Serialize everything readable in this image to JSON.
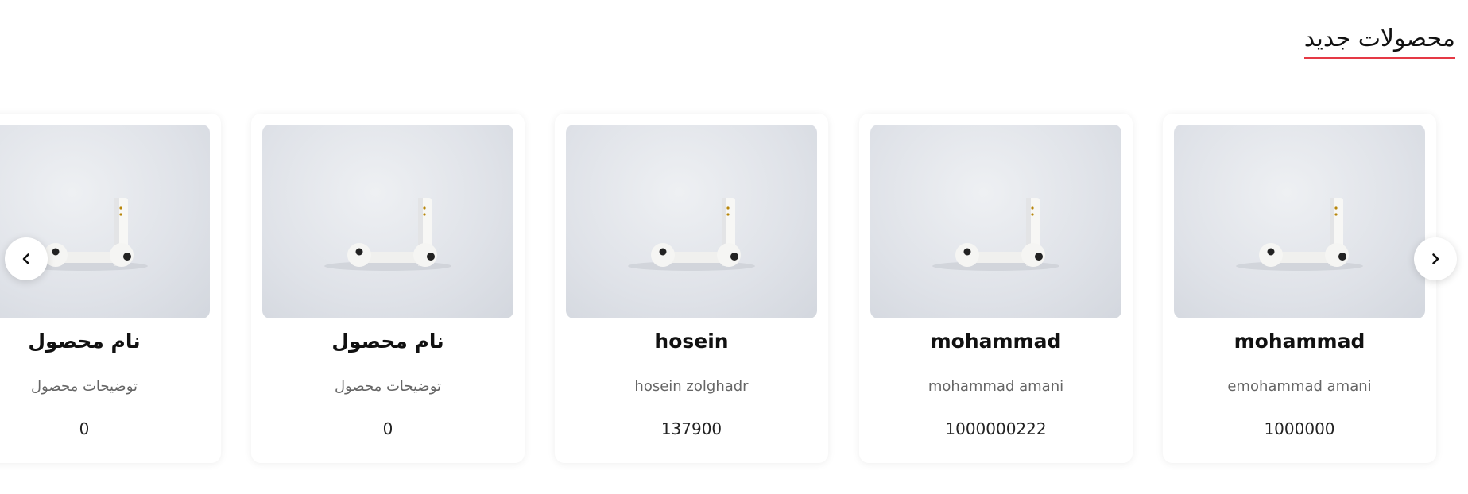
{
  "section": {
    "title": "محصولات جدید"
  },
  "carousel": {
    "prev_icon": "chevron-left-icon",
    "next_icon": "chevron-right-icon",
    "products": [
      {
        "name": "mohammad",
        "description": "emohammad amani",
        "price": "1000000"
      },
      {
        "name": "mohammad",
        "description": "mohammad amani",
        "price": "1000000222"
      },
      {
        "name": "hosein",
        "description": "hosein zolghadr",
        "price": "137900"
      },
      {
        "name": "نام محصول",
        "description": "توضیحات محصول",
        "price": "0"
      },
      {
        "name": "نام محصول",
        "description": "توضیحات محصول",
        "price": "0"
      }
    ]
  }
}
